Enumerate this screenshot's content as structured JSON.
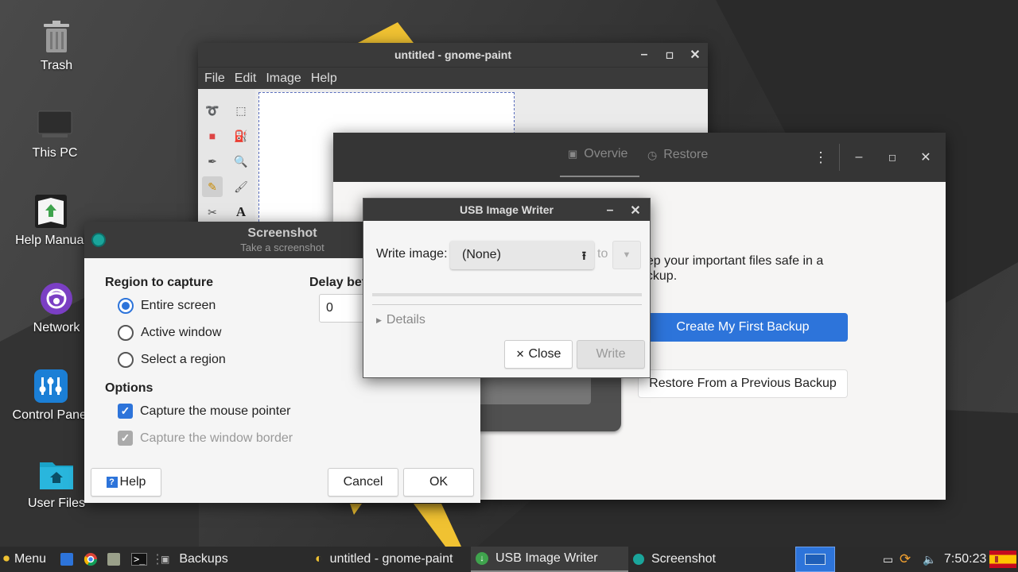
{
  "desktop": {
    "icons": [
      {
        "label": "Trash",
        "icon": "trash-icon"
      },
      {
        "label": "This PC",
        "icon": "computer-icon"
      },
      {
        "label": "Help Manual",
        "icon": "help-manual-icon"
      },
      {
        "label": "Network",
        "icon": "network-icon"
      },
      {
        "label": "Control Panel",
        "icon": "control-panel-icon"
      },
      {
        "label": "User Files",
        "icon": "home-folder-icon"
      }
    ]
  },
  "paint": {
    "title": "untitled - gnome-paint",
    "menu": [
      "File",
      "Edit",
      "Image",
      "Help"
    ]
  },
  "backups": {
    "tabs": [
      "Overvie",
      "Restore"
    ],
    "description": "eep your important files safe in a\nackup.",
    "primary_button": "Create My First Backup",
    "secondary_button": "Restore From a Previous Backup"
  },
  "screenshot": {
    "title": "Screenshot",
    "subtitle": "Take a screenshot",
    "region_heading": "Region to capture",
    "regions": [
      "Entire screen",
      "Active window",
      "Select a region"
    ],
    "selected_region": "Entire screen",
    "delay_label": "Delay bef",
    "delay_value": "0",
    "options_heading": "Options",
    "options": [
      {
        "label": "Capture the mouse pointer",
        "checked": true,
        "enabled": true
      },
      {
        "label": "Capture the window border",
        "checked": true,
        "enabled": false
      }
    ],
    "help_button": "Help",
    "cancel_button": "Cancel",
    "ok_button": "OK"
  },
  "usb": {
    "title": "USB Image Writer",
    "write_label": "Write image:",
    "image_value": "(None)",
    "to_label": "to",
    "details_label": "Details",
    "close_button": "Close",
    "write_button": "Write"
  },
  "taskbar": {
    "menu_label": "Menu",
    "tasks": [
      "Backups",
      "untitled - gnome-paint",
      "USB Image Writer",
      "Screenshot"
    ],
    "active_task": "USB Image Writer",
    "clock": "7:50:23",
    "accent": "#2d74da"
  }
}
